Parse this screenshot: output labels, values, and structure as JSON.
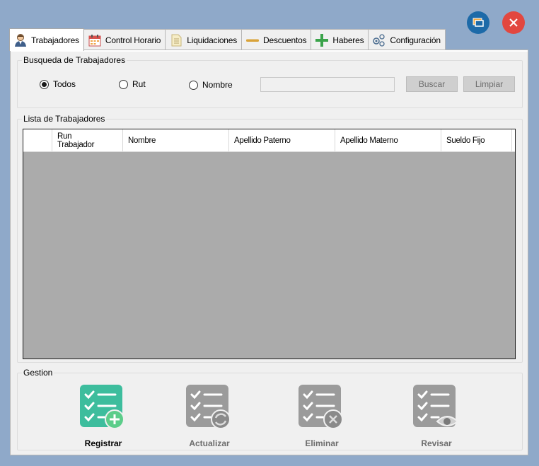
{
  "window": {
    "controls": [
      {
        "name": "minimize",
        "icon": "window-stack-icon",
        "color": "#1d6aa8"
      },
      {
        "name": "close",
        "icon": "close-icon",
        "color": "#e2473f"
      }
    ]
  },
  "tabs": [
    {
      "label": "Trabajadores",
      "icon": "worker-icon",
      "active": true
    },
    {
      "label": "Control Horario",
      "icon": "calendar-icon",
      "active": false
    },
    {
      "label": "Liquidaciones",
      "icon": "document-icon",
      "active": false
    },
    {
      "label": "Descuentos",
      "icon": "minus-icon",
      "active": false
    },
    {
      "label": "Haberes",
      "icon": "plus-icon",
      "active": false
    },
    {
      "label": "Configuración",
      "icon": "gears-icon",
      "active": false
    }
  ],
  "search": {
    "title": "Busqueda de Trabajadores",
    "options": [
      {
        "label": "Todos",
        "checked": true
      },
      {
        "label": "Rut",
        "checked": false
      },
      {
        "label": "Nombre",
        "checked": false
      }
    ],
    "input_value": "",
    "search_button": "Buscar",
    "clear_button": "Limpiar"
  },
  "list": {
    "title": "Lista de Trabajadores",
    "columns": [
      "Run\nTrabajador",
      "Nombre",
      "Apellido Paterno",
      "Apellido Materno",
      "Sueldo Fijo"
    ],
    "rows": []
  },
  "gestion": {
    "title": "Gestion",
    "actions": [
      {
        "label": "Registrar",
        "icon": "checklist-add-icon",
        "enabled": true,
        "color": "#3dbd9d"
      },
      {
        "label": "Actualizar",
        "icon": "checklist-refresh-icon",
        "enabled": false,
        "color": "#9b9b9b"
      },
      {
        "label": "Eliminar",
        "icon": "checklist-delete-icon",
        "enabled": false,
        "color": "#9b9b9b"
      },
      {
        "label": "Revisar",
        "icon": "checklist-view-icon",
        "enabled": false,
        "color": "#9b9b9b"
      }
    ]
  }
}
